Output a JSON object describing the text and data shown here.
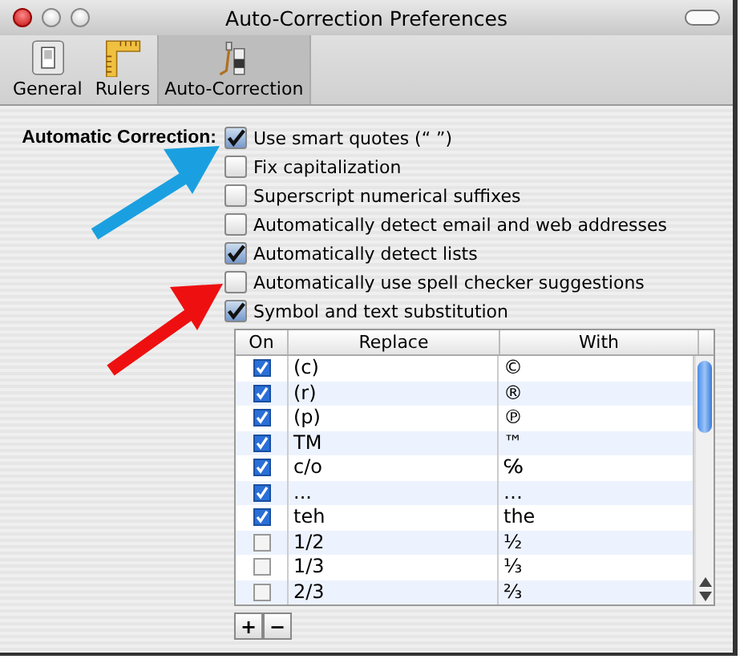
{
  "window": {
    "title": "Auto-Correction Preferences"
  },
  "toolbar": [
    {
      "label": "General",
      "kind": "general",
      "selected": false
    },
    {
      "label": "Rulers",
      "kind": "rulers",
      "selected": false
    },
    {
      "label": "Auto-Correction",
      "kind": "autocorrect",
      "selected": true
    }
  ],
  "section_label": "Automatic Correction:",
  "options": [
    {
      "label": "Use smart quotes (“ ”)",
      "checked": true
    },
    {
      "label": "Fix capitalization",
      "checked": false
    },
    {
      "label": "Superscript numerical suffixes",
      "checked": false
    },
    {
      "label": "Automatically detect email and web addresses",
      "checked": false
    },
    {
      "label": "Automatically detect lists",
      "checked": true
    },
    {
      "label": "Automatically use spell checker suggestions",
      "checked": false
    },
    {
      "label": "Symbol and text substitution",
      "checked": true
    }
  ],
  "table": {
    "columns": [
      "On",
      "Replace",
      "With"
    ],
    "rows": [
      {
        "on": true,
        "replace": "(c)",
        "with": "©"
      },
      {
        "on": true,
        "replace": "(r)",
        "with": "®"
      },
      {
        "on": true,
        "replace": "(p)",
        "with": "℗"
      },
      {
        "on": true,
        "replace": "TM",
        "with": "™"
      },
      {
        "on": true,
        "replace": "c/o",
        "with": "℅"
      },
      {
        "on": true,
        "replace": "...",
        "with": "…"
      },
      {
        "on": true,
        "replace": "teh",
        "with": "the"
      },
      {
        "on": false,
        "replace": "1/2",
        "with": "½"
      },
      {
        "on": false,
        "replace": "1/3",
        "with": "⅓"
      },
      {
        "on": false,
        "replace": "2/3",
        "with": "⅔"
      }
    ]
  },
  "buttons": [
    "+",
    "−"
  ]
}
